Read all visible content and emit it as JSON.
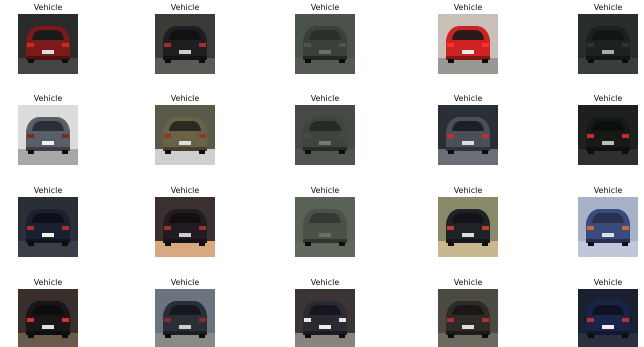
{
  "grid": {
    "columns": 5,
    "rows": 4,
    "cells": [
      {
        "label": "Vehicle",
        "image": "rear view of dark car with red body, street background"
      },
      {
        "label": "Vehicle",
        "image": "rear view of dark sedan on road"
      },
      {
        "label": "Vehicle",
        "image": "blurry rear of dark van"
      },
      {
        "label": "Vehicle",
        "image": "rear of red car"
      },
      {
        "label": "Vehicle",
        "image": "rear of black car close-up"
      },
      {
        "label": "Vehicle",
        "image": "rear of grey hatchback"
      },
      {
        "label": "Vehicle",
        "image": "rear of gold sedan"
      },
      {
        "label": "Vehicle",
        "image": "rear of grey minivan"
      },
      {
        "label": "Vehicle",
        "image": "rear of grey car with red lights"
      },
      {
        "label": "Vehicle",
        "image": "rear of black car with red lights"
      },
      {
        "label": "Vehicle",
        "image": "rear of dark blue car with white plate"
      },
      {
        "label": "Vehicle",
        "image": "rear of dark SUV on street"
      },
      {
        "label": "Vehicle",
        "image": "rear of grey van blurry"
      },
      {
        "label": "Vehicle",
        "image": "rear of dark car on sunny road"
      },
      {
        "label": "Vehicle",
        "image": "blurry rear of blue car"
      },
      {
        "label": "Vehicle",
        "image": "rear of black car with red lights"
      },
      {
        "label": "Vehicle",
        "image": "rear of dark station wagon"
      },
      {
        "label": "Vehicle",
        "image": "rear of dark car with bright lights"
      },
      {
        "label": "Vehicle",
        "image": "rear of dark car with plate"
      },
      {
        "label": "Vehicle",
        "image": "rear of blue car"
      }
    ]
  },
  "colors": {
    "background": "#ffffff",
    "label": "#111111"
  }
}
